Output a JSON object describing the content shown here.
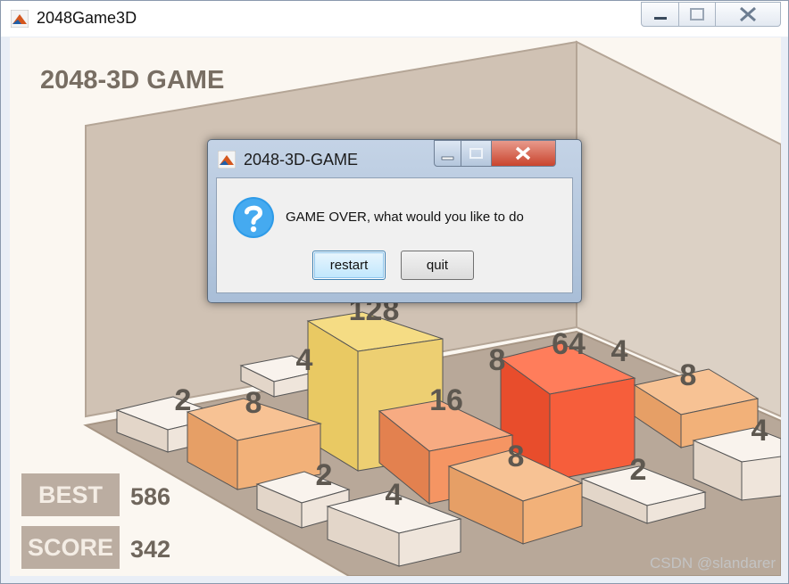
{
  "window": {
    "title": "2048Game3D"
  },
  "game": {
    "title": "2048-3D GAME"
  },
  "stats": {
    "best_label": "BEST",
    "best_value": "586",
    "score_label": "SCORE",
    "score_value": "342"
  },
  "dialog": {
    "title": "2048-3D-GAME",
    "message": "GAME OVER, what would you like to do",
    "restart_label": "restart",
    "quit_label": "quit",
    "icon": "question-icon"
  },
  "board": {
    "tile_labels": [
      "128",
      "4",
      "8",
      "64",
      "4",
      "8",
      "2",
      "8",
      "16",
      "4",
      "2",
      "4",
      "8",
      "2"
    ]
  },
  "colors": {
    "tile_2": "#efe5db",
    "tile_4": "#ede0c8",
    "tile_8": "#f2b179",
    "tile_16": "#f59563",
    "tile_64": "#f65e3b",
    "tile_128": "#edcf72"
  },
  "watermark": "CSDN @slandarer"
}
